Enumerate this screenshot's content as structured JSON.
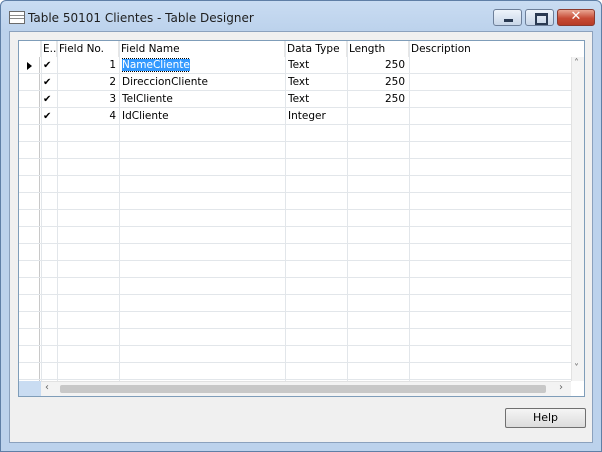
{
  "window": {
    "title": "Table 50101 Clientes - Table Designer",
    "close_glyph": "✕"
  },
  "columns": [
    "E...",
    "Field No.",
    "Field Name",
    "Data Type",
    "Length",
    "Description"
  ],
  "rows": [
    {
      "enabled": "✔",
      "field_no": "1",
      "field_name": "NameCliente",
      "data_type": "Text",
      "length": "250",
      "description": ""
    },
    {
      "enabled": "✔",
      "field_no": "2",
      "field_name": "DireccionCliente",
      "data_type": "Text",
      "length": "250",
      "description": ""
    },
    {
      "enabled": "✔",
      "field_no": "3",
      "field_name": "TelCliente",
      "data_type": "Text",
      "length": "250",
      "description": ""
    },
    {
      "enabled": "✔",
      "field_no": "4",
      "field_name": "IdCliente",
      "data_type": "Integer",
      "length": "",
      "description": ""
    }
  ],
  "scroll": {
    "up": "˄",
    "down": "˅",
    "left": "‹",
    "right": "›"
  },
  "help_label": "Help",
  "icons": {
    "window": "table-icon",
    "current_row": "row-pointer-icon"
  },
  "colors": {
    "titlebar": "#bcd2ec",
    "selection": "#3399ff",
    "close_button": "#c74b35"
  }
}
